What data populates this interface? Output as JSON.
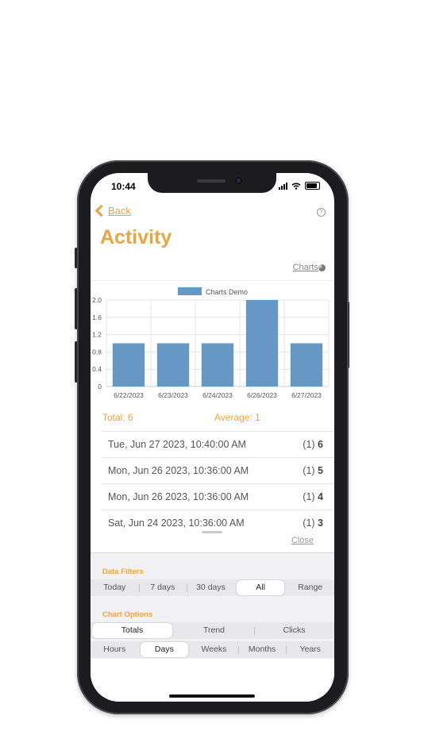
{
  "status_bar": {
    "time": "10:44"
  },
  "nav": {
    "back_label": "Back",
    "help_icon": "question-circle-icon"
  },
  "page": {
    "title": "Activity",
    "charts_link": "Charts"
  },
  "chart_data": {
    "type": "bar",
    "legend": "Charts Demo",
    "categories": [
      "6/22/2023",
      "6/23/2023",
      "6/24/2023",
      "6/26/2023",
      "6/27/2023"
    ],
    "values": [
      1,
      1,
      1,
      2,
      1
    ],
    "ylim": [
      0,
      2.0
    ],
    "yticks": [
      "0",
      "0.4",
      "0.8",
      "1.2",
      "1.6",
      "2.0"
    ],
    "color": "#6698c6",
    "grid": true,
    "legend_position": "top"
  },
  "summary": {
    "total": "Total: 6",
    "average": "Average: 1"
  },
  "entries": [
    {
      "date": "Tue, Jun 27 2023, 10:40:00 AM",
      "count_prefix": "(1)",
      "count": "6"
    },
    {
      "date": "Mon, Jun 26 2023, 10:36:00 AM",
      "count_prefix": "(1)",
      "count": "5"
    },
    {
      "date": "Mon, Jun 26 2023, 10:36:00 AM",
      "count_prefix": "(1)",
      "count": "4"
    },
    {
      "date": "Sat, Jun 24 2023, 10:36:00 AM",
      "count_prefix": "(1)",
      "count": "3"
    }
  ],
  "close_label": "Close",
  "filters": {
    "title": "Data Filters",
    "options": [
      "Today",
      "7 days",
      "30 days",
      "All",
      "Range"
    ],
    "selected": "All"
  },
  "chart_options": {
    "title": "Chart Options",
    "modes": [
      "Totals",
      "Trend",
      "Clicks"
    ],
    "selected_mode": "Totals",
    "periods": [
      "Hours",
      "Days",
      "Weeks",
      "Months",
      "Years"
    ],
    "selected_period": "Days"
  },
  "colors": {
    "accent": "#e9a443",
    "bar": "#6698c6"
  }
}
